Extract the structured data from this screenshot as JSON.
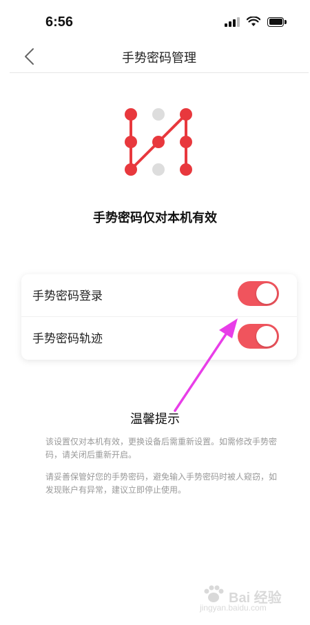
{
  "status_bar": {
    "time": "6:56",
    "icons": [
      "signal-icon",
      "wifi-icon",
      "battery-icon"
    ]
  },
  "nav": {
    "title": "手势密码管理",
    "back_icon": "chevron-left-icon"
  },
  "subtitle": "手势密码仅对本机有效",
  "settings": [
    {
      "label": "手势密码登录",
      "enabled": true
    },
    {
      "label": "手势密码轨迹",
      "enabled": true
    }
  ],
  "tips": {
    "title": "温馨提示",
    "paragraphs": [
      "该设置仅对本机有效，更换设备后需重新设置。如需修改手势密码，请关闭后重新开启。",
      "请妥善保管好您的手势密码，避免输入手势密码时被人窥窃，如发现账户有异常，建议立即停止使用。"
    ]
  },
  "watermark": {
    "text": "Bai 经验",
    "url": "jingyan.baidu.com"
  },
  "colors": {
    "accent": "#f0545d",
    "pattern_red": "#e8383d",
    "pattern_gray": "#dddddd",
    "annotation_arrow": "#e83ee8"
  }
}
